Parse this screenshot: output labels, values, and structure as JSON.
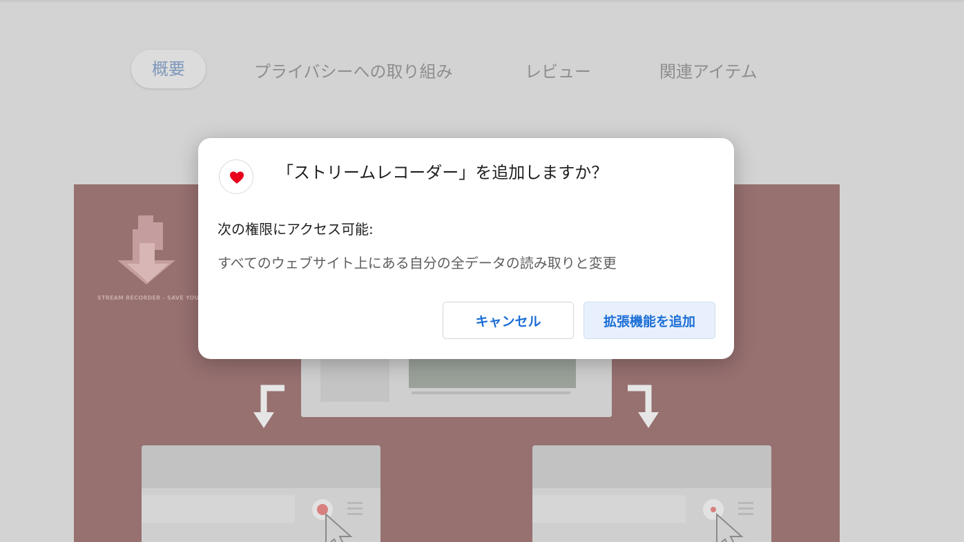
{
  "tabs": [
    {
      "label": "概要",
      "active": true
    },
    {
      "label": "プライバシーへの取り組み",
      "active": false
    },
    {
      "label": "レビュー",
      "active": false
    },
    {
      "label": "関連アイテム",
      "active": false
    }
  ],
  "banner": {
    "logo_caption": "STREAM RECORDER - SAVE YOUR LIVE"
  },
  "dialog": {
    "icon": "red-heart-icon",
    "title": "「ストリームレコーダー」を追加しますか？",
    "permission_heading": "次の権限にアクセス可能:",
    "permission_item": "すべてのウェブサイト上にある自分の全データの読み取りと変更",
    "cancel_label": "キャンセル",
    "add_label": "拡張機能を追加"
  },
  "colors": {
    "accent": "#1b6ed6",
    "heart": "#e8001c",
    "banner_bg": "#977070"
  }
}
